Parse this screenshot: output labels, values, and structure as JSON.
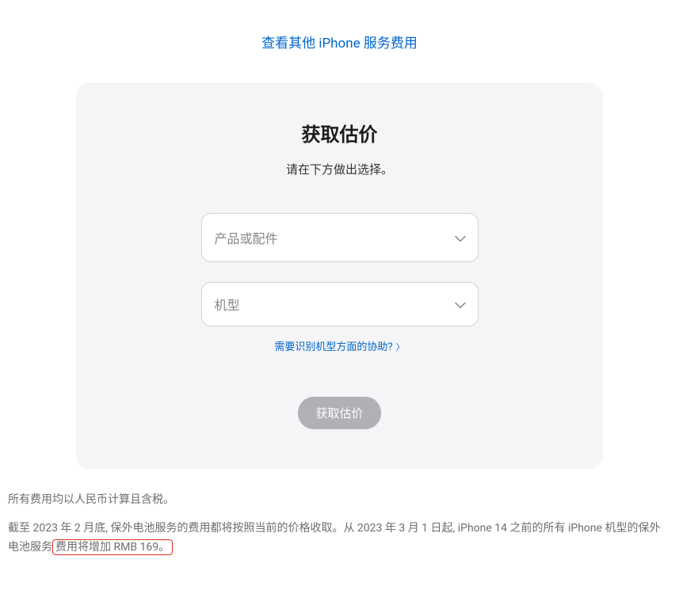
{
  "topLink": {
    "text": "查看其他 iPhone 服务费用"
  },
  "card": {
    "title": "获取估价",
    "subtitle": "请在下方做出选择。",
    "select1": {
      "placeholder": "产品或配件"
    },
    "select2": {
      "placeholder": "机型"
    },
    "helpLink": {
      "text": "需要识别机型方面的协助?"
    },
    "submitButton": "获取估价"
  },
  "footer": {
    "line1": "所有费用均以人民币计算且含税。",
    "line2_part1": "截至 2023 年 2 月底, 保外电池服务的费用都将按照当前的价格收取。从 2023 年 3 月 1 日起, iPhone 14 之前的所有 iPhone 机型的保外电池服务",
    "line2_highlight": "费用将增加 RMB 169。"
  }
}
